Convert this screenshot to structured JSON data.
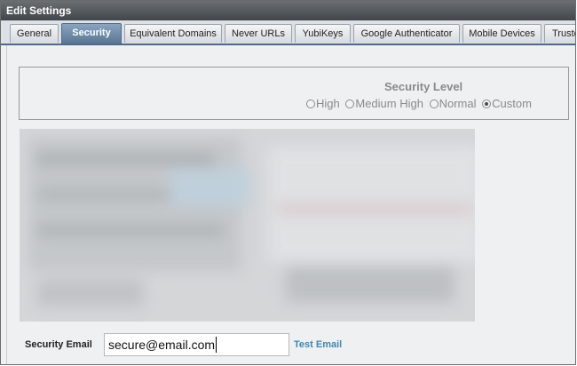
{
  "window": {
    "title": "Edit Settings"
  },
  "tabs": [
    {
      "label": "General",
      "active": false
    },
    {
      "label": "Security",
      "active": true
    },
    {
      "label": "Equivalent Domains",
      "active": false
    },
    {
      "label": "Never URLs",
      "active": false
    },
    {
      "label": "YubiKeys",
      "active": false
    },
    {
      "label": "Google Authenticator",
      "active": false
    },
    {
      "label": "Mobile Devices",
      "active": false
    },
    {
      "label": "Truste",
      "active": false
    }
  ],
  "security_level": {
    "title": "Security Level",
    "options": [
      {
        "label": "High",
        "checked": false
      },
      {
        "label": "Medium High",
        "checked": false
      },
      {
        "label": "Normal",
        "checked": false
      },
      {
        "label": "Custom",
        "checked": true
      }
    ]
  },
  "security_email": {
    "label": "Security Email",
    "value": "secure@email.com",
    "test_link": "Test Email"
  },
  "colors": {
    "active_tab": "#587694",
    "link": "#3f88b3",
    "disabled_text": "#8a8a8a"
  }
}
